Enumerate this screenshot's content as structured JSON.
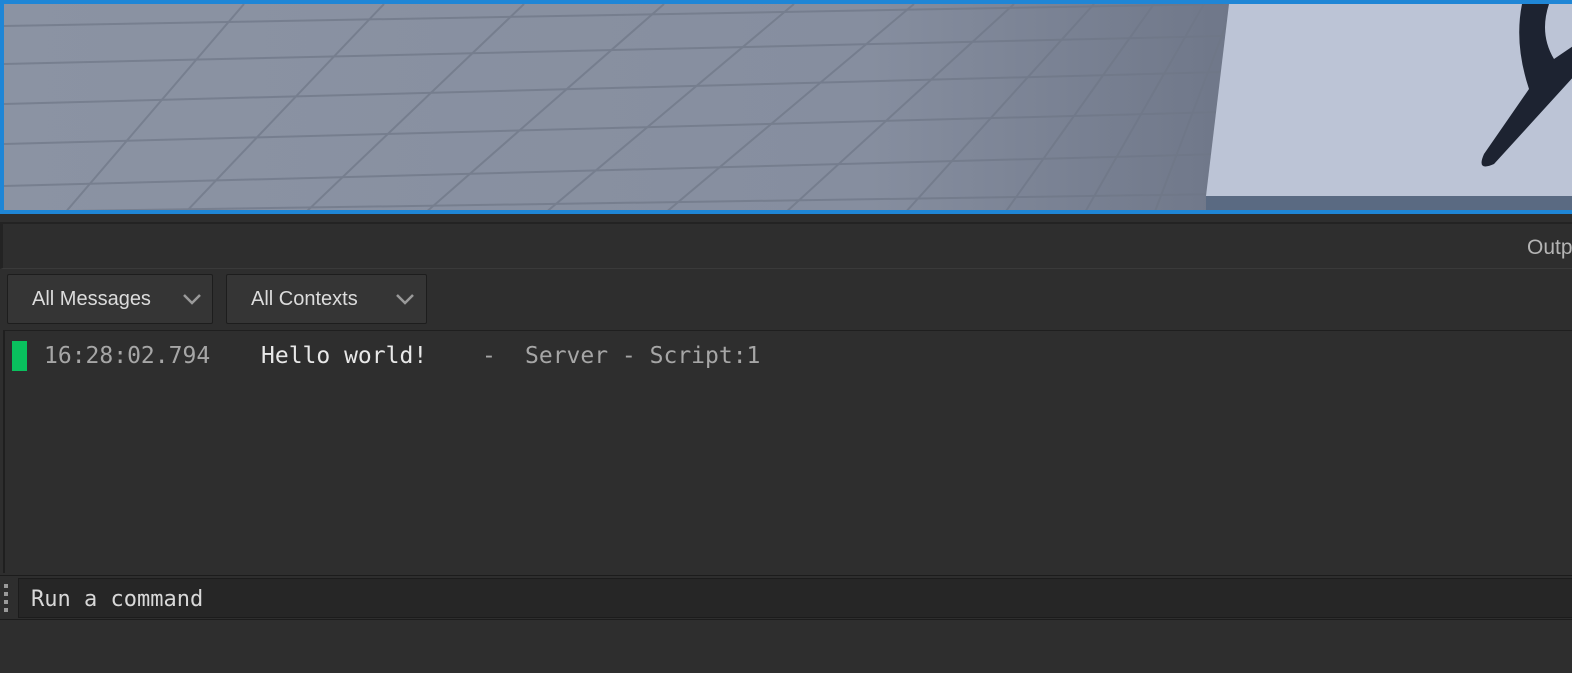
{
  "viewport": {
    "colors": {
      "frame": "#1f86d6",
      "floor": "#7e8696",
      "block": "#bcc4d6",
      "shadow_mark": "#1d2331"
    }
  },
  "output_panel": {
    "title": "Outp"
  },
  "filters": {
    "messages": "All Messages",
    "contexts": "All Contexts"
  },
  "log": {
    "entries": [
      {
        "level_color": "#09c15e",
        "time": "16:28:02.794",
        "message": "Hello world!",
        "separator": "-",
        "source": "Server - Script:1"
      }
    ]
  },
  "command": {
    "text": "Run a command"
  }
}
